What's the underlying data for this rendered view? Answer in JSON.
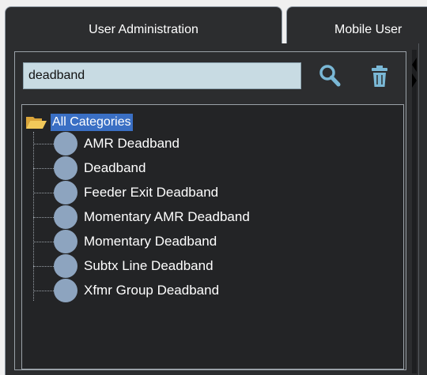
{
  "tabs": [
    {
      "label": "User Administration"
    },
    {
      "label": "Mobile User"
    }
  ],
  "search": {
    "value": "deadband"
  },
  "icons": {
    "search": "search-icon",
    "delete": "trash-icon",
    "folder": "folder-open-icon",
    "node": "circle-node-icon"
  },
  "tree": {
    "root_label": "All Categories",
    "items": [
      {
        "label": "AMR Deadband"
      },
      {
        "label": "Deadband"
      },
      {
        "label": "Feeder Exit Deadband"
      },
      {
        "label": "Momentary AMR Deadband"
      },
      {
        "label": "Momentary Deadband"
      },
      {
        "label": "Subtx Line Deadband"
      },
      {
        "label": "Xfmr Group Deadband"
      }
    ]
  },
  "colors": {
    "panel_bg": "#2c2d2f",
    "input_bg": "#c8dbe3",
    "selection": "#3a6fc4",
    "node_dot": "#8da4bf",
    "search_icon": "#7ab8d6"
  }
}
